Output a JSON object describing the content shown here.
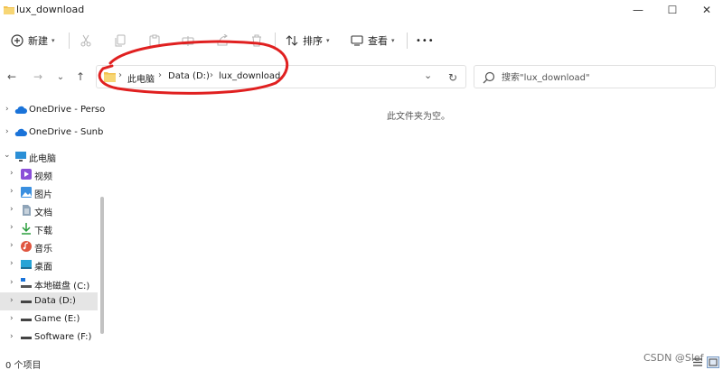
{
  "window": {
    "title": "lux_download",
    "minimize_glyph": "—",
    "maximize_glyph": "☐",
    "close_glyph": "✕"
  },
  "toolbar": {
    "new_label": "新建",
    "sort_label": "排序",
    "view_label": "查看",
    "more_glyph": "•••",
    "caret": "▾"
  },
  "nav": {
    "back_glyph": "←",
    "forward_glyph": "→",
    "recent_glyph": "⌄",
    "up_glyph": "↑",
    "dropdown_glyph": "⌄",
    "refresh_glyph": "↻"
  },
  "address": {
    "sep": "›",
    "crumbs": [
      "此电脑",
      "Data (D:)",
      "lux_download"
    ]
  },
  "search": {
    "placeholder": "搜索\"lux_download\""
  },
  "sidebar": {
    "items": [
      {
        "label": "OneDrive - Perso",
        "icon": "cloud-icon",
        "chev": "›"
      },
      {
        "label": "OneDrive - Sunb",
        "icon": "cloud-icon",
        "chev": "›"
      },
      {
        "label": "此电脑",
        "icon": "computer-icon",
        "chev": "⌄"
      },
      {
        "label": "视频",
        "icon": "video-icon",
        "chev": "›"
      },
      {
        "label": "图片",
        "icon": "pictures-icon",
        "chev": "›"
      },
      {
        "label": "文档",
        "icon": "documents-icon",
        "chev": "›"
      },
      {
        "label": "下载",
        "icon": "download-icon",
        "chev": "›"
      },
      {
        "label": "音乐",
        "icon": "music-icon",
        "chev": "›"
      },
      {
        "label": "桌面",
        "icon": "desktop-icon",
        "chev": "›"
      },
      {
        "label": "本地磁盘 (C:)",
        "icon": "windows-drive-icon",
        "chev": "›"
      },
      {
        "label": "Data (D:)",
        "icon": "drive-icon",
        "chev": "›"
      },
      {
        "label": "Game (E:)",
        "icon": "drive-icon",
        "chev": "›"
      },
      {
        "label": "Software (F:)",
        "icon": "drive-icon",
        "chev": "›"
      }
    ]
  },
  "content": {
    "empty_message": "此文件夹为空。"
  },
  "status": {
    "item_count": "0 个项目",
    "watermark": "CSDN @Slef"
  },
  "colors": {
    "accent": "#0067c0",
    "annotation": "#e02020",
    "folder": "#f2c14e",
    "selected_bg": "#e5e5e5"
  }
}
